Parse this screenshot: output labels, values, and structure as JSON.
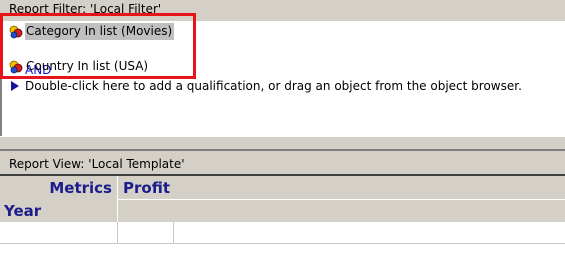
{
  "report_filter": {
    "title": "Report Filter: 'Local Filter'",
    "qualifications": [
      {
        "label": "Category In list (Movies)",
        "icon": "qualification-icon",
        "selected": true
      },
      {
        "label": "Country In list (USA)",
        "icon": "qualification-icon",
        "selected": false
      }
    ],
    "operator": "AND",
    "hint": "Double-click here to add a qualification, or drag an object from the object browser."
  },
  "report_view": {
    "title": "Report View: 'Local Template'",
    "grid": {
      "metrics_label": "Metrics",
      "row_header": "Year",
      "column_header": "Profit"
    }
  },
  "colors": {
    "highlight_border": "#e8141a",
    "operator_text": "#1414c8",
    "grid_header_text": "#1c1c8c",
    "pane_background": "#d4d0c8"
  }
}
